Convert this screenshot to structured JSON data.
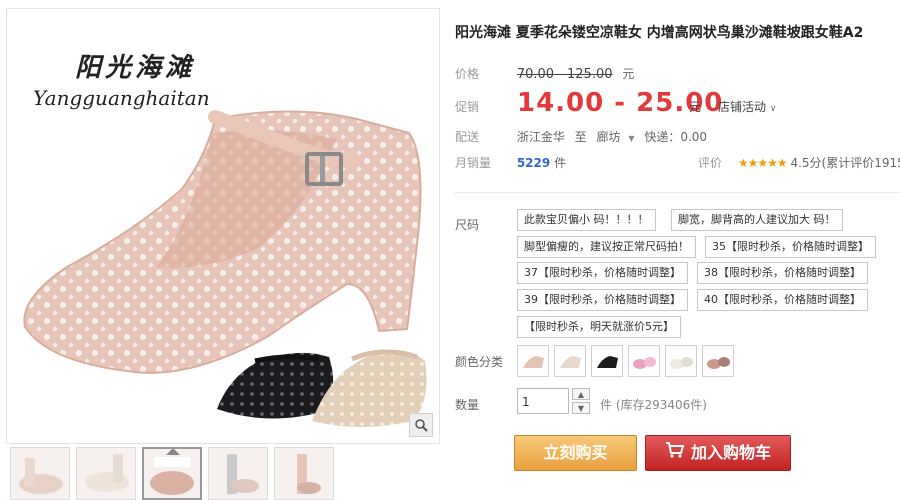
{
  "brand": {
    "cn": "阳光海滩",
    "en": "Yangguanghaitan"
  },
  "title": "阳光海滩 夏季花朵镂空凉鞋女 内增高网状鸟巢沙滩鞋坡跟女鞋A2",
  "price": {
    "label": "价格",
    "value": "70.00 - 125.00",
    "unit": "元"
  },
  "promo": {
    "label": "促销",
    "value": "14.00 - 25.00",
    "unit": "元",
    "shop_promo": "店铺活动"
  },
  "shipping": {
    "label": "配送",
    "from": "浙江金华",
    "to_word": "至",
    "to": "廊坊",
    "express": "快递：0.00"
  },
  "sales": {
    "label": "月销量",
    "value": "5229",
    "unit": "件"
  },
  "rating": {
    "label": "评价",
    "stars": "★★★★★",
    "score": "4.5分(累计评价1915"
  },
  "size": {
    "label": "尺码",
    "options": [
      "此款宝贝偏小  码！！！！",
      "脚宽，脚背高的人建议加大  码！",
      "脚型偏瘦的，建议按正常尺码拍！",
      "35【限时秒杀，价格随时调整】",
      "37【限时秒杀，价格随时调整】",
      "38【限时秒杀，价格随时调整】",
      "39【限时秒杀，价格随时调整】",
      "40【限时秒杀，价格随时调整】",
      "【限时秒杀，明天就涨价5元】"
    ]
  },
  "color": {
    "label": "颜色分类",
    "count": 6
  },
  "quantity": {
    "label": "数量",
    "value": "1",
    "stock": "件 (库存293406件)"
  },
  "buttons": {
    "buy": "立刻购买",
    "cart": "加入购物车"
  },
  "colors": {
    "accent_red": "#e4393c",
    "buy_orange": "#e9a03e",
    "cart_red": "#c32323",
    "shoe_pink": "#e9cbbf"
  }
}
